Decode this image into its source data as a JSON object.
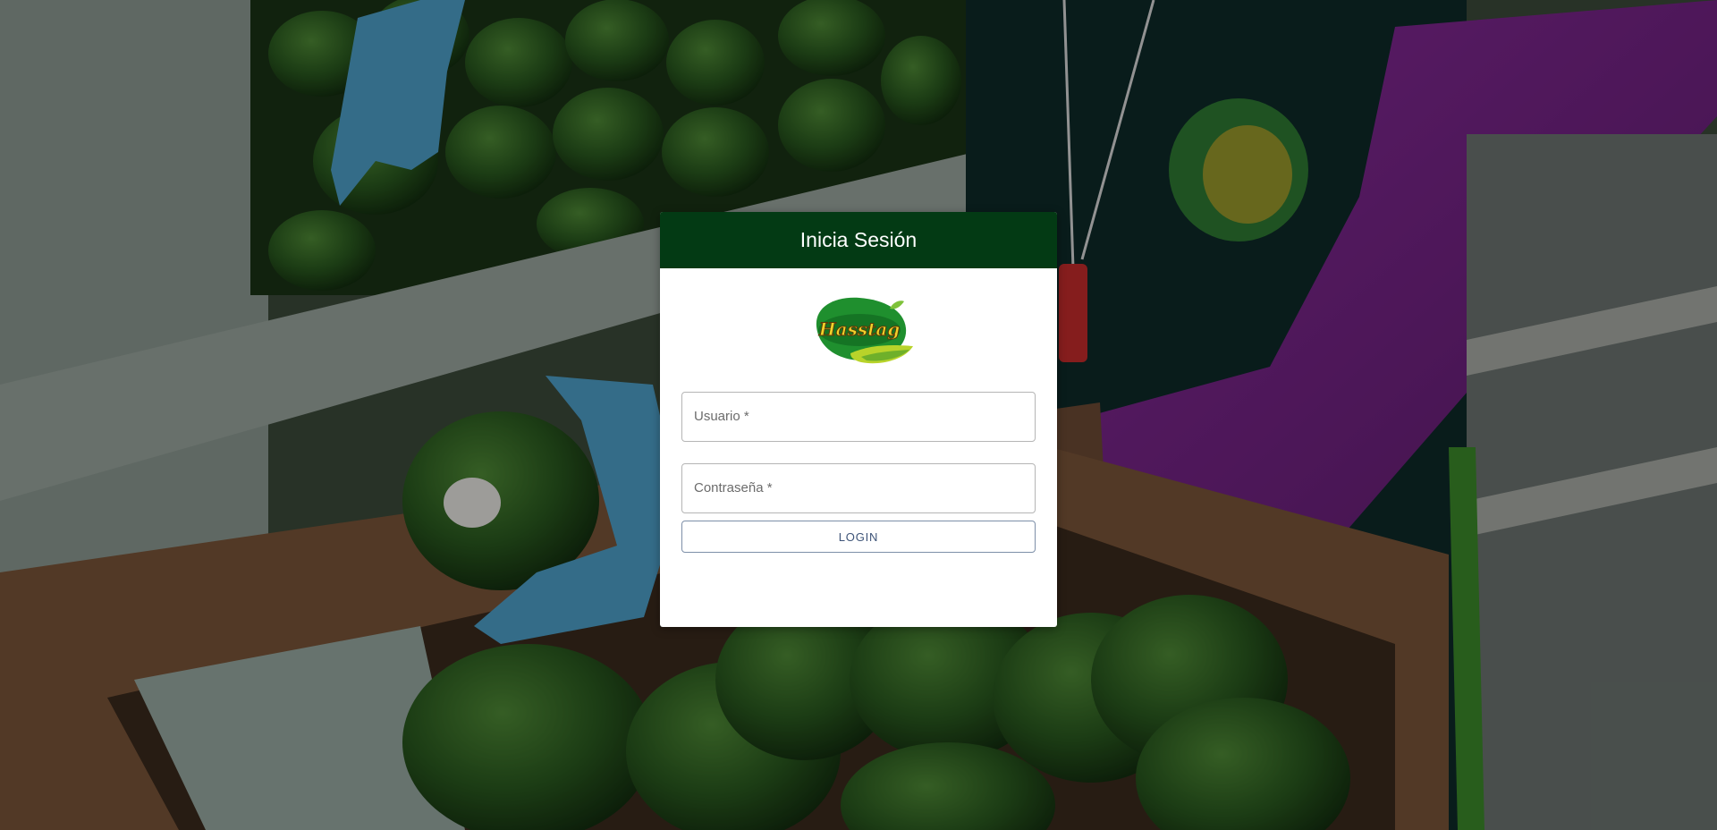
{
  "login": {
    "title": "Inicia Sesión",
    "username": {
      "label": "Usuario *",
      "value": ""
    },
    "password": {
      "label": "Contraseña *",
      "value": ""
    },
    "submit_label": "LOGIN"
  },
  "logo": {
    "brand_text": "Hasstag"
  },
  "background": {
    "description_icon": "avocado-packing-photo"
  },
  "colors": {
    "header": "#033a14",
    "button_text": "#3e5478",
    "card": "#ffffff"
  }
}
